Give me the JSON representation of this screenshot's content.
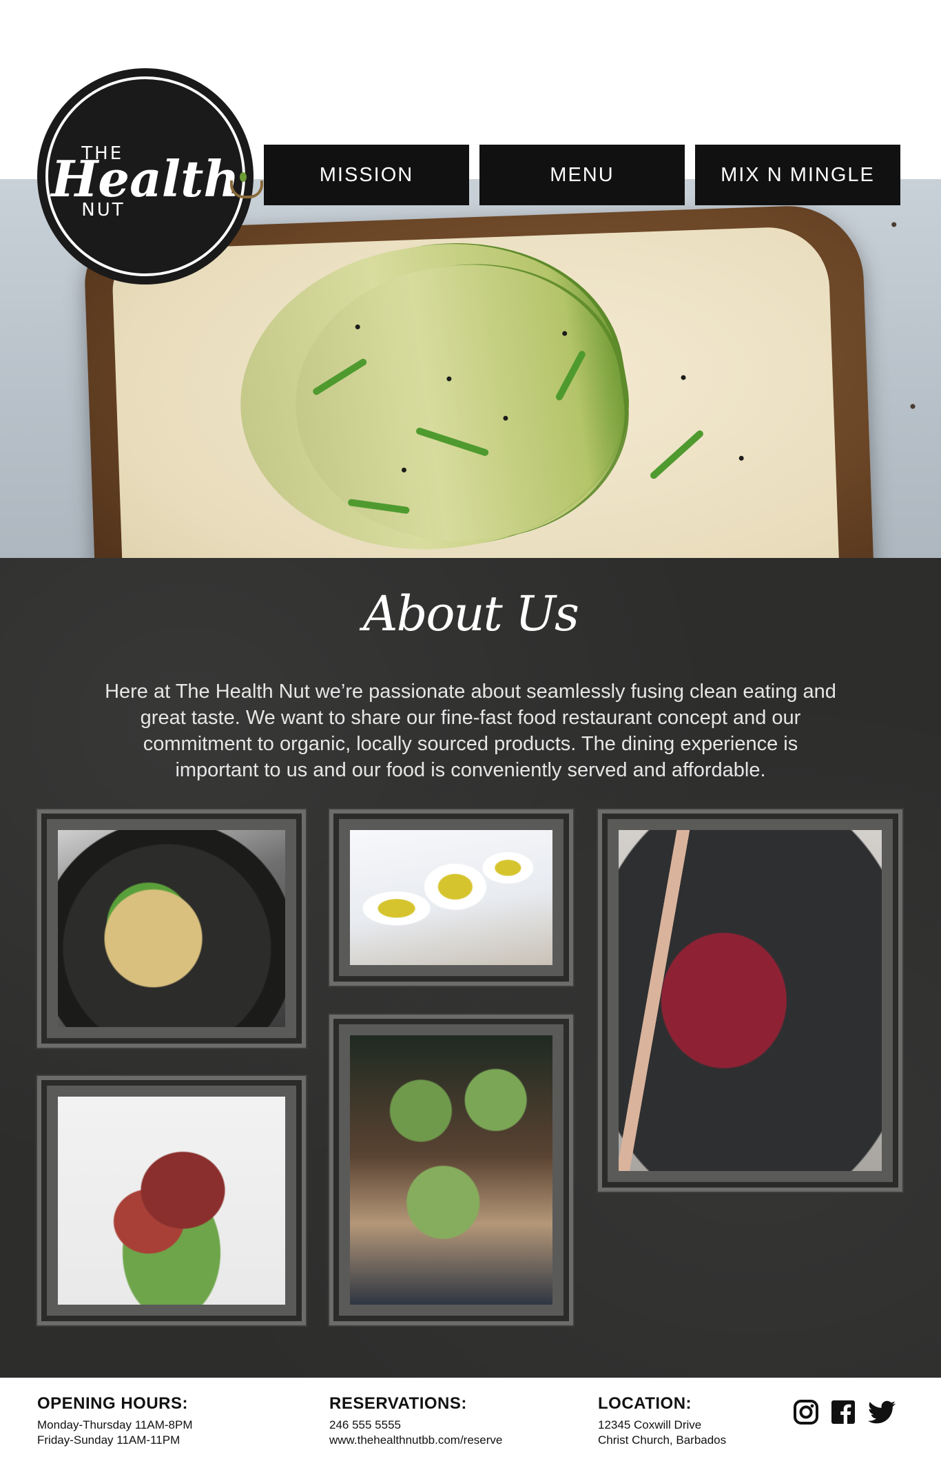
{
  "logo": {
    "line1": "THE",
    "line2": "Health",
    "line3": "NUT"
  },
  "nav": [
    {
      "label": "MISSION"
    },
    {
      "label": "MENU"
    },
    {
      "label": "MIX N MINGLE"
    }
  ],
  "about": {
    "title": "About Us",
    "body": "Here at The Health Nut we’re passionate about seamlessly fusing clean eating and great taste.  We want to share our fine-fast food restaurant concept and our commitment to organic, locally sourced products. The dining experience is important to us and our food is conveniently served and affordable."
  },
  "footer": {
    "hours": {
      "heading": "OPENING HOURS:",
      "lines": [
        "Monday-Thursday 11AM-8PM",
        "Friday-Sunday 11AM-11PM"
      ]
    },
    "reservations": {
      "heading": "RESERVATIONS:",
      "lines": [
        "246 555 5555",
        "www.thehealthnutbb.com/reserve"
      ]
    },
    "location": {
      "heading": "LOCATION:",
      "lines": [
        "12345 Coxwill Drive",
        "Christ Church, Barbados"
      ]
    },
    "social": [
      "instagram-icon",
      "facebook-icon",
      "twitter-icon"
    ]
  },
  "colors": {
    "dark": "#111111",
    "chalkboard": "#2d2d2c",
    "frame": "#5a5a59"
  }
}
